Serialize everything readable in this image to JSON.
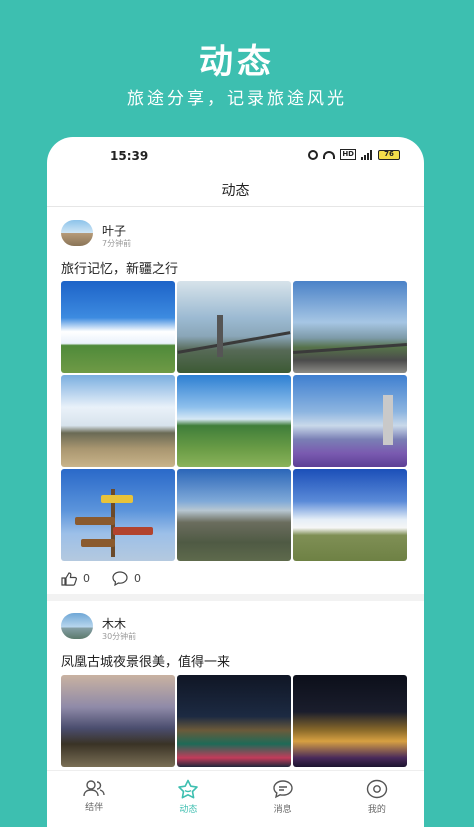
{
  "promo": {
    "title": "动态",
    "subtitle": "旅途分享，记录旅途风光"
  },
  "status_bar": {
    "time": "15:39",
    "network_badge": "HD",
    "battery": "76"
  },
  "nav": {
    "title": "动态"
  },
  "posts": [
    {
      "user": "叶子",
      "time": "7分钟前",
      "text": "旅行记忆，新疆之行",
      "likes": "0",
      "comments": "0"
    },
    {
      "user": "木木",
      "time": "30分钟前",
      "text": "凤凰古城夜景很美，值得一来"
    }
  ],
  "tabs": [
    {
      "label": "结伴",
      "icon": "companion-icon",
      "active": false
    },
    {
      "label": "动态",
      "icon": "star-feed-icon",
      "active": true
    },
    {
      "label": "消息",
      "icon": "message-icon",
      "active": false
    },
    {
      "label": "我的",
      "icon": "profile-icon",
      "active": false
    }
  ],
  "colors": {
    "brand": "#3dbfb0",
    "active_tab": "#3dbfb0"
  }
}
